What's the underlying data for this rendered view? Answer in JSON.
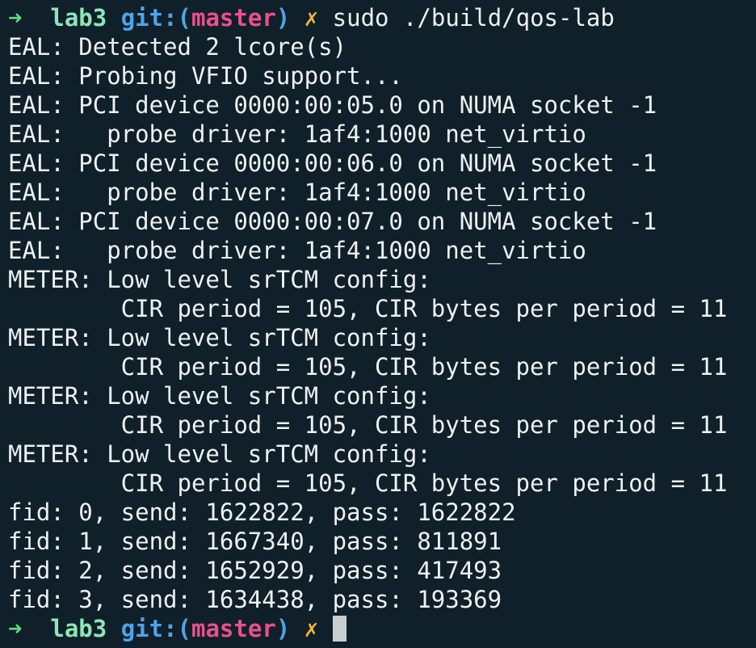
{
  "terminal": {
    "prompt": {
      "arrow": "➜",
      "dir": "lab3",
      "git_prefix": "git:(",
      "branch": "master",
      "git_suffix": ")",
      "dirty_mark": "✗"
    },
    "command": "sudo ./build/qos-lab",
    "output": [
      "EAL: Detected 2 lcore(s)",
      "EAL: Probing VFIO support...",
      "EAL: PCI device 0000:00:05.0 on NUMA socket -1",
      "EAL:   probe driver: 1af4:1000 net_virtio",
      "EAL: PCI device 0000:00:06.0 on NUMA socket -1",
      "EAL:   probe driver: 1af4:1000 net_virtio",
      "EAL: PCI device 0000:00:07.0 on NUMA socket -1",
      "EAL:   probe driver: 1af4:1000 net_virtio",
      "METER: Low level srTCM config:",
      "        CIR period = 105, CIR bytes per period = 11",
      "METER: Low level srTCM config:",
      "        CIR period = 105, CIR bytes per period = 11",
      "METER: Low level srTCM config:",
      "        CIR period = 105, CIR bytes per period = 11",
      "METER: Low level srTCM config:",
      "        CIR period = 105, CIR bytes per period = 11",
      "fid: 0, send: 1622822, pass: 1622822",
      "fid: 1, send: 1667340, pass: 811891",
      "fid: 2, send: 1652929, pass: 417493",
      "fid: 3, send: 1634438, pass: 193369"
    ]
  },
  "colors": {
    "background": "#10202a",
    "text": "#eef1f2",
    "arrow": "#5fdc7c",
    "dir": "#8ee6b8",
    "git": "#4fa3e8",
    "branch": "#ec4f8c",
    "dirty": "#f2b43a",
    "cursor": "#c8cdd0"
  }
}
